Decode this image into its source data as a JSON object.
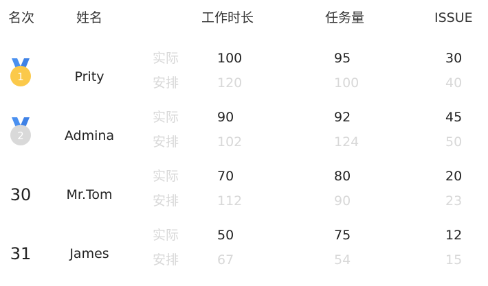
{
  "header": {
    "rank": "名次",
    "name": "姓名",
    "hours": "工作时长",
    "tasks": "任务量",
    "issue": "ISSUE"
  },
  "labels": {
    "actual": "实际",
    "planned": "安排"
  },
  "medal_colors": {
    "ribbon": "#4a90f0",
    "gold": "#fbc94a",
    "silver": "#d9d9d9"
  },
  "rows": [
    {
      "rank": "1",
      "rank_display": "gold-medal-icon",
      "name": "Prity",
      "hours": {
        "actual": "100",
        "planned": "120"
      },
      "tasks": {
        "actual": "95",
        "planned": "100"
      },
      "issue": {
        "actual": "30",
        "planned": "40"
      }
    },
    {
      "rank": "2",
      "rank_display": "silver-medal-icon",
      "name": "Admina",
      "hours": {
        "actual": "90",
        "planned": "102"
      },
      "tasks": {
        "actual": "92",
        "planned": "124"
      },
      "issue": {
        "actual": "45",
        "planned": "50"
      }
    },
    {
      "rank": "30",
      "rank_display": "text",
      "name": "Mr.Tom",
      "hours": {
        "actual": "70",
        "planned": "112"
      },
      "tasks": {
        "actual": "80",
        "planned": "90"
      },
      "issue": {
        "actual": "20",
        "planned": "23"
      }
    },
    {
      "rank": "31",
      "rank_display": "text",
      "name": "James",
      "hours": {
        "actual": "50",
        "planned": "67"
      },
      "tasks": {
        "actual": "75",
        "planned": "54"
      },
      "issue": {
        "actual": "12",
        "planned": "15"
      }
    }
  ]
}
